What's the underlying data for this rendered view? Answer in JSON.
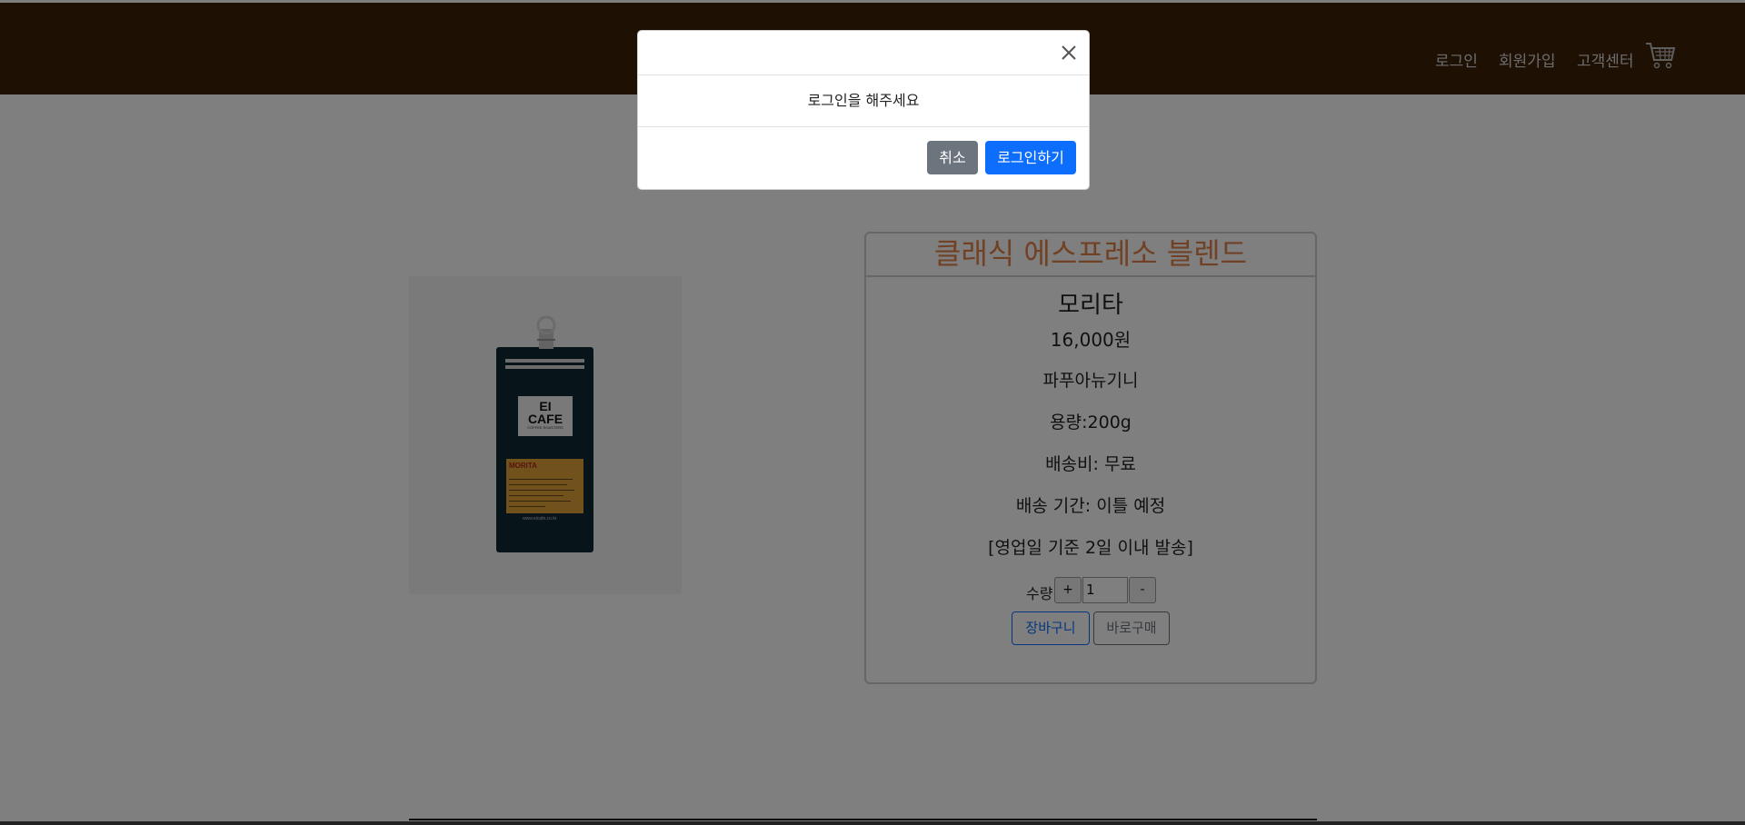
{
  "header": {
    "nav": {
      "login": "로그인",
      "signup": "회원가입",
      "customer_center": "고객센터"
    },
    "cart_icon": "cart-icon",
    "background_color": "#3d2209"
  },
  "product": {
    "category_title": "클래식 에스프레소 블렌드",
    "name": "모리타",
    "price": "16,000원",
    "origin": "파푸아뉴기니",
    "weight": "용량:200g",
    "shipping_fee": "배송비: 무료",
    "shipping_period": "배송 기간: 이틀 예정",
    "dispatch_note": "[영업일 기준 2일 이내 발송]",
    "quantity_label": "수량",
    "quantity_plus": "+",
    "quantity_value": "1",
    "quantity_minus": "-",
    "add_to_cart_label": "장바구니",
    "buy_now_label": "바로구매",
    "image": {
      "brand_line1": "EI",
      "brand_line2": "CAFE",
      "brand_sub": "COFFEE ROASTERS",
      "label_title": "MORITA",
      "url": "www.eicafe.co.kr"
    },
    "title_color": "#e0824a"
  },
  "modal": {
    "message": "로그인을 해주세요",
    "cancel_label": "취소",
    "login_label": "로그인하기",
    "close_icon": "close-icon",
    "primary_color": "#0d6efd",
    "secondary_color": "#6c757d"
  }
}
